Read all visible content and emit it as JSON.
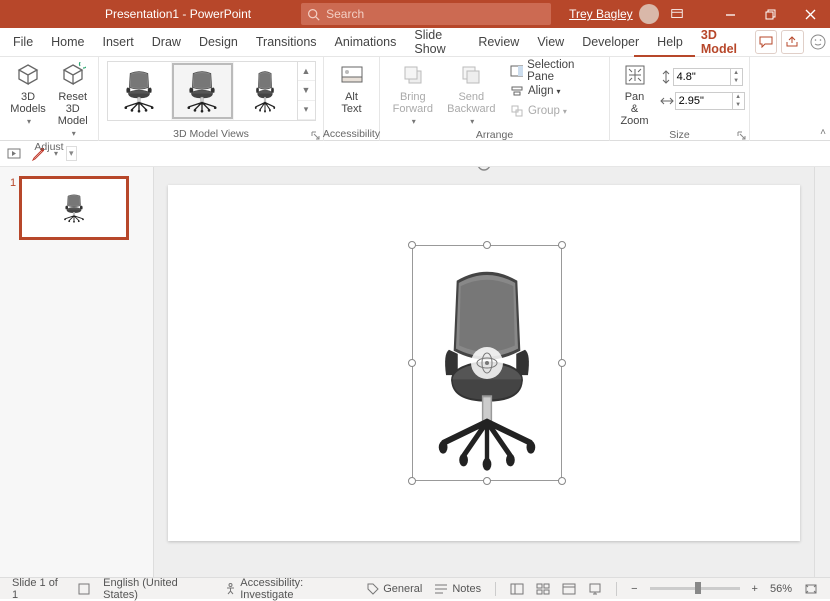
{
  "titlebar": {
    "title": "Presentation1 - PowerPoint",
    "search_placeholder": "Search",
    "user_name": "Trey Bagley"
  },
  "tabs": {
    "items": [
      "File",
      "Home",
      "Insert",
      "Draw",
      "Design",
      "Transitions",
      "Animations",
      "Slide Show",
      "Review",
      "View",
      "Developer",
      "Help",
      "3D Model"
    ],
    "active": "3D Model"
  },
  "ribbon": {
    "adjust": {
      "models": "3D Models",
      "reset": "Reset 3D Model",
      "label": "Adjust"
    },
    "views": {
      "label": "3D Model Views"
    },
    "accessibility": {
      "alttext": "Alt Text",
      "label": "Accessibility"
    },
    "arrange": {
      "bring": "Bring Forward",
      "send": "Send Backward",
      "selection": "Selection Pane",
      "align": "Align",
      "group": "Group",
      "label": "Arrange"
    },
    "size": {
      "pan": "Pan & Zoom",
      "height": "4.8\"",
      "width": "2.95\"",
      "label": "Size"
    }
  },
  "thumbpanel": {
    "slide_num": "1"
  },
  "status": {
    "slide": "Slide 1 of 1",
    "lang": "English (United States)",
    "access": "Accessibility: Investigate",
    "general": "General",
    "notes": "Notes",
    "zoom": "56%"
  }
}
